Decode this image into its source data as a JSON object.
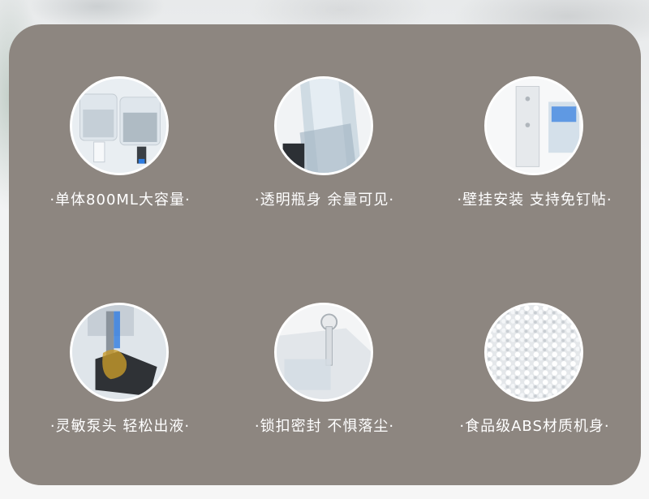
{
  "features": [
    {
      "label": "·单体800ML大容量·",
      "image": "dispenser-pair-icon"
    },
    {
      "label": "·透明瓶身 余量可见·",
      "image": "transparent-bottle-icon"
    },
    {
      "label": "·壁挂安装 支持免钉帖·",
      "image": "wall-mount-icon"
    },
    {
      "label": "·灵敏泵头 轻松出液·",
      "image": "pump-head-icon"
    },
    {
      "label": "·锁扣密封 不惧落尘·",
      "image": "lock-key-icon"
    },
    {
      "label": "·食品级ABS材质机身·",
      "image": "abs-granules-icon"
    }
  ],
  "colors": {
    "panel": "#8d8680",
    "text": "#ffffff",
    "ring": "#ffffff"
  }
}
